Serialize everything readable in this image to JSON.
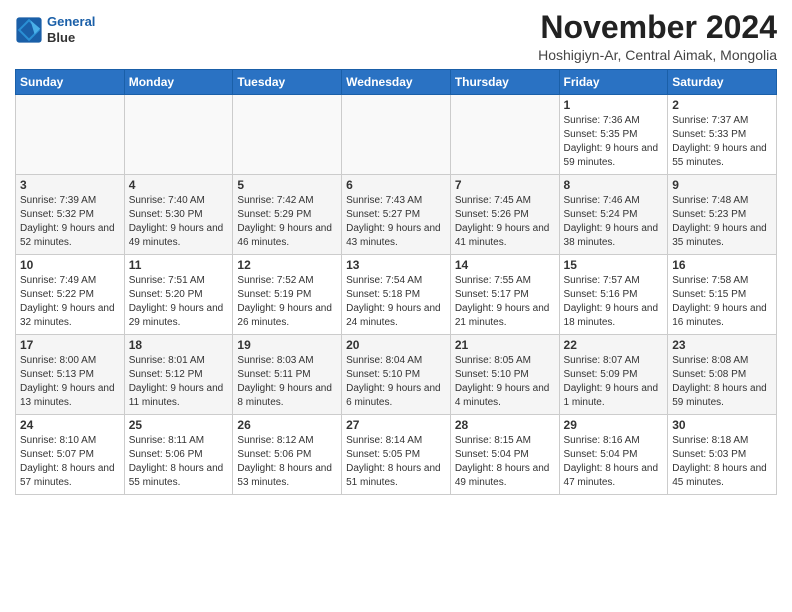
{
  "header": {
    "logo_line1": "General",
    "logo_line2": "Blue",
    "month": "November 2024",
    "location": "Hoshigiyn-Ar, Central Aimak, Mongolia"
  },
  "days_of_week": [
    "Sunday",
    "Monday",
    "Tuesday",
    "Wednesday",
    "Thursday",
    "Friday",
    "Saturday"
  ],
  "weeks": [
    [
      {
        "day": "",
        "info": ""
      },
      {
        "day": "",
        "info": ""
      },
      {
        "day": "",
        "info": ""
      },
      {
        "day": "",
        "info": ""
      },
      {
        "day": "",
        "info": ""
      },
      {
        "day": "1",
        "info": "Sunrise: 7:36 AM\nSunset: 5:35 PM\nDaylight: 9 hours and 59 minutes."
      },
      {
        "day": "2",
        "info": "Sunrise: 7:37 AM\nSunset: 5:33 PM\nDaylight: 9 hours and 55 minutes."
      }
    ],
    [
      {
        "day": "3",
        "info": "Sunrise: 7:39 AM\nSunset: 5:32 PM\nDaylight: 9 hours and 52 minutes."
      },
      {
        "day": "4",
        "info": "Sunrise: 7:40 AM\nSunset: 5:30 PM\nDaylight: 9 hours and 49 minutes."
      },
      {
        "day": "5",
        "info": "Sunrise: 7:42 AM\nSunset: 5:29 PM\nDaylight: 9 hours and 46 minutes."
      },
      {
        "day": "6",
        "info": "Sunrise: 7:43 AM\nSunset: 5:27 PM\nDaylight: 9 hours and 43 minutes."
      },
      {
        "day": "7",
        "info": "Sunrise: 7:45 AM\nSunset: 5:26 PM\nDaylight: 9 hours and 41 minutes."
      },
      {
        "day": "8",
        "info": "Sunrise: 7:46 AM\nSunset: 5:24 PM\nDaylight: 9 hours and 38 minutes."
      },
      {
        "day": "9",
        "info": "Sunrise: 7:48 AM\nSunset: 5:23 PM\nDaylight: 9 hours and 35 minutes."
      }
    ],
    [
      {
        "day": "10",
        "info": "Sunrise: 7:49 AM\nSunset: 5:22 PM\nDaylight: 9 hours and 32 minutes."
      },
      {
        "day": "11",
        "info": "Sunrise: 7:51 AM\nSunset: 5:20 PM\nDaylight: 9 hours and 29 minutes."
      },
      {
        "day": "12",
        "info": "Sunrise: 7:52 AM\nSunset: 5:19 PM\nDaylight: 9 hours and 26 minutes."
      },
      {
        "day": "13",
        "info": "Sunrise: 7:54 AM\nSunset: 5:18 PM\nDaylight: 9 hours and 24 minutes."
      },
      {
        "day": "14",
        "info": "Sunrise: 7:55 AM\nSunset: 5:17 PM\nDaylight: 9 hours and 21 minutes."
      },
      {
        "day": "15",
        "info": "Sunrise: 7:57 AM\nSunset: 5:16 PM\nDaylight: 9 hours and 18 minutes."
      },
      {
        "day": "16",
        "info": "Sunrise: 7:58 AM\nSunset: 5:15 PM\nDaylight: 9 hours and 16 minutes."
      }
    ],
    [
      {
        "day": "17",
        "info": "Sunrise: 8:00 AM\nSunset: 5:13 PM\nDaylight: 9 hours and 13 minutes."
      },
      {
        "day": "18",
        "info": "Sunrise: 8:01 AM\nSunset: 5:12 PM\nDaylight: 9 hours and 11 minutes."
      },
      {
        "day": "19",
        "info": "Sunrise: 8:03 AM\nSunset: 5:11 PM\nDaylight: 9 hours and 8 minutes."
      },
      {
        "day": "20",
        "info": "Sunrise: 8:04 AM\nSunset: 5:10 PM\nDaylight: 9 hours and 6 minutes."
      },
      {
        "day": "21",
        "info": "Sunrise: 8:05 AM\nSunset: 5:10 PM\nDaylight: 9 hours and 4 minutes."
      },
      {
        "day": "22",
        "info": "Sunrise: 8:07 AM\nSunset: 5:09 PM\nDaylight: 9 hours and 1 minute."
      },
      {
        "day": "23",
        "info": "Sunrise: 8:08 AM\nSunset: 5:08 PM\nDaylight: 8 hours and 59 minutes."
      }
    ],
    [
      {
        "day": "24",
        "info": "Sunrise: 8:10 AM\nSunset: 5:07 PM\nDaylight: 8 hours and 57 minutes."
      },
      {
        "day": "25",
        "info": "Sunrise: 8:11 AM\nSunset: 5:06 PM\nDaylight: 8 hours and 55 minutes."
      },
      {
        "day": "26",
        "info": "Sunrise: 8:12 AM\nSunset: 5:06 PM\nDaylight: 8 hours and 53 minutes."
      },
      {
        "day": "27",
        "info": "Sunrise: 8:14 AM\nSunset: 5:05 PM\nDaylight: 8 hours and 51 minutes."
      },
      {
        "day": "28",
        "info": "Sunrise: 8:15 AM\nSunset: 5:04 PM\nDaylight: 8 hours and 49 minutes."
      },
      {
        "day": "29",
        "info": "Sunrise: 8:16 AM\nSunset: 5:04 PM\nDaylight: 8 hours and 47 minutes."
      },
      {
        "day": "30",
        "info": "Sunrise: 8:18 AM\nSunset: 5:03 PM\nDaylight: 8 hours and 45 minutes."
      }
    ]
  ]
}
